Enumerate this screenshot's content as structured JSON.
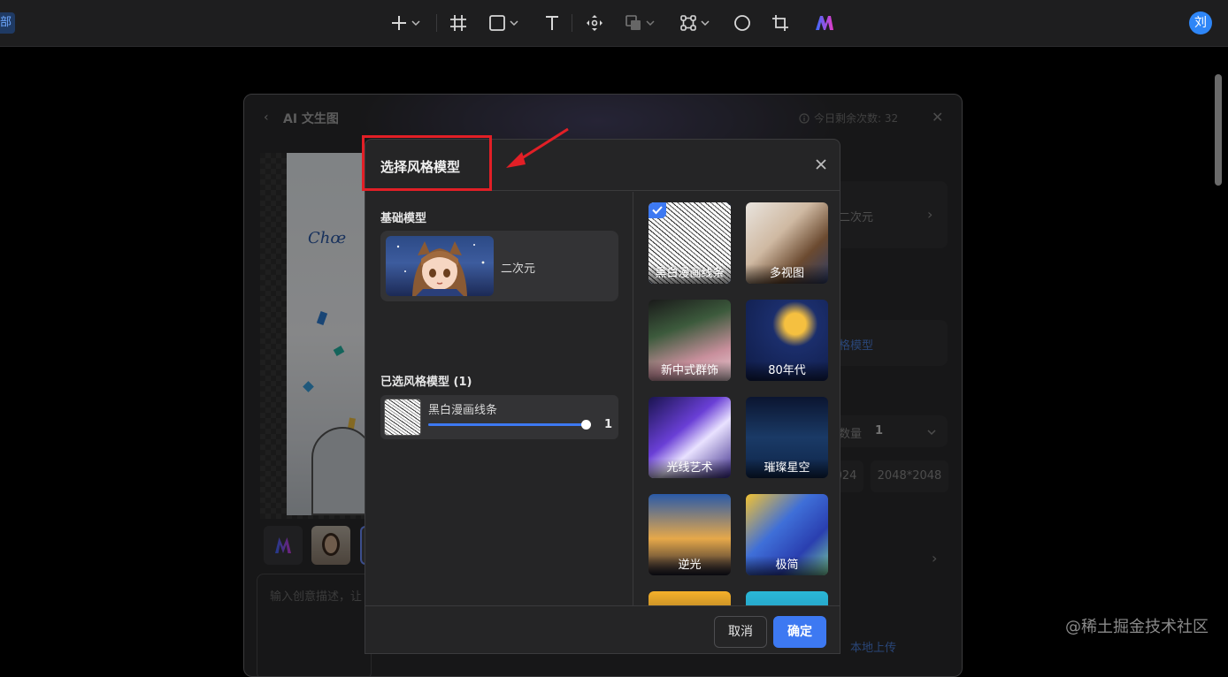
{
  "topbar": {
    "breadcrumb": "部",
    "user_initial": "刘"
  },
  "background_panel": {
    "title": "AI 文生图",
    "remaining_label": "今日剩余次数: 32",
    "prompt_placeholder": "输入创意描述，让",
    "right_style_value": "二次元",
    "right_link": "格模型",
    "count_label": "数量",
    "count_value": "1",
    "size_partial": "024",
    "size_option": "2048*2048",
    "upload_link": "本地上传"
  },
  "modal": {
    "title": "选择风格模型",
    "base_section": "基础模型",
    "base_model_name": "二次元",
    "selected_section": "已选风格模型 (1)",
    "selected_model_name": "黑白漫画线条",
    "selected_weight": "1",
    "selected_weight_fraction": 1.0,
    "styles": [
      {
        "label": "黑白漫画线条",
        "selected": true
      },
      {
        "label": "多视图",
        "selected": false
      },
      {
        "label": "新中式群饰",
        "selected": false
      },
      {
        "label": "80年代",
        "selected": false
      },
      {
        "label": "光线艺术",
        "selected": false
      },
      {
        "label": "璀璨星空",
        "selected": false
      },
      {
        "label": "逆光",
        "selected": false
      },
      {
        "label": "极简",
        "selected": false
      },
      {
        "label": "",
        "selected": false
      },
      {
        "label": "",
        "selected": false
      }
    ],
    "cancel_label": "取消",
    "confirm_label": "确定"
  },
  "watermark": "@稀土掘金技术社区",
  "colors": {
    "accent": "#3d79f2",
    "highlight": "#e21f26",
    "topbar": "#1e1e1f",
    "modal_bg": "#252526"
  }
}
